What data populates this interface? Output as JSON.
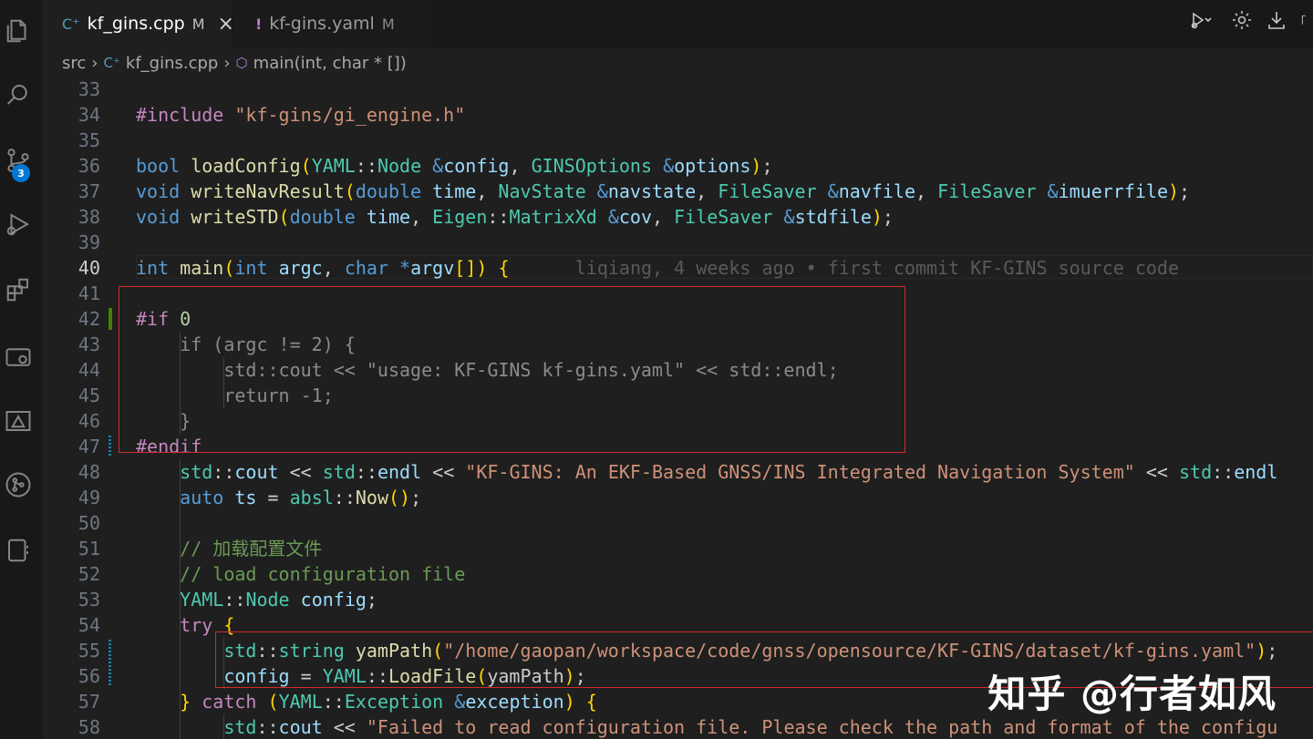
{
  "activity_bar": {
    "icons": [
      "files-icon",
      "search-icon",
      "source-control-icon",
      "run-debug-icon",
      "extensions-icon",
      "remote-explorer-icon",
      "deploy-icon",
      "git-graph-icon",
      "device-icon"
    ],
    "scm_badge": "3"
  },
  "tabs": [
    {
      "label": "kf_gins.cpp",
      "icon": "C⁺",
      "status": "M",
      "active": true
    },
    {
      "label": "kf-gins.yaml",
      "icon": "!",
      "status": "M",
      "active": false
    }
  ],
  "toolbar": {
    "icons": [
      "run-debug-dropdown-icon",
      "gear-icon",
      "download-icon",
      "more-icon"
    ]
  },
  "breadcrumb": {
    "items": [
      "src",
      "kf_gins.cpp",
      "main(int, char * [])"
    ]
  },
  "editor": {
    "current_line": 40,
    "blame": "liqiang, 4 weeks ago • first commit KF-GINS source code",
    "lines": [
      {
        "n": "33",
        "code": ""
      },
      {
        "n": "34",
        "code": "#include \"kf-gins/gi_engine.h\""
      },
      {
        "n": "35",
        "code": ""
      },
      {
        "n": "36",
        "code": "bool loadConfig(YAML::Node &config, GINSOptions &options);"
      },
      {
        "n": "37",
        "code": "void writeNavResult(double time, NavState &navstate, FileSaver &navfile, FileSaver &imuerrfile);"
      },
      {
        "n": "38",
        "code": "void writeSTD(double time, Eigen::MatrixXd &cov, FileSaver &stdfile);"
      },
      {
        "n": "39",
        "code": ""
      },
      {
        "n": "40",
        "code": "int main(int argc, char *argv[]) {"
      },
      {
        "n": "41",
        "code": ""
      },
      {
        "n": "42",
        "code": "#if 0"
      },
      {
        "n": "43",
        "code": "    if (argc != 2) {"
      },
      {
        "n": "44",
        "code": "        std::cout << \"usage: KF-GINS kf-gins.yaml\" << std::endl;"
      },
      {
        "n": "45",
        "code": "        return -1;"
      },
      {
        "n": "46",
        "code": "    }"
      },
      {
        "n": "47",
        "code": "#endif"
      },
      {
        "n": "48",
        "code": "    std::cout << std::endl << \"KF-GINS: An EKF-Based GNSS/INS Integrated Navigation System\" << std::endl"
      },
      {
        "n": "49",
        "code": "    auto ts = absl::Now();"
      },
      {
        "n": "50",
        "code": ""
      },
      {
        "n": "51",
        "code": "    // 加载配置文件"
      },
      {
        "n": "52",
        "code": "    // load configuration file"
      },
      {
        "n": "53",
        "code": "    YAML::Node config;"
      },
      {
        "n": "54",
        "code": "    try {"
      },
      {
        "n": "55",
        "code": "        std::string yamPath(\"/home/gaopan/workspace/code/gnss/opensource/KF-GINS/dataset/kf-gins.yaml\");"
      },
      {
        "n": "56",
        "code": "        config = YAML::LoadFile(yamPath);"
      },
      {
        "n": "57",
        "code": "    } catch (YAML::Exception &exception) {"
      },
      {
        "n": "58",
        "code": "        std::cout << \"Failed to read configuration file. Please check the path and format of the configu"
      }
    ]
  },
  "watermark": "知乎 @行者如风",
  "colors": {
    "keyword": "#569cd6",
    "type": "#4ec9b0",
    "function": "#dcdcaa",
    "string": "#ce9178",
    "variable": "#9cdcfe",
    "comment": "#6a9955",
    "preproc": "#c586c0",
    "inactive": "#8b8b8b",
    "highlight_box": "#d22a2a",
    "git_added": "#487e02",
    "git_modified": "#1b81a8"
  }
}
